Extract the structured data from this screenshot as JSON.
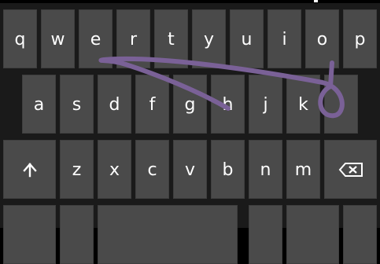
{
  "keyboard": {
    "row1": [
      "q",
      "w",
      "e",
      "r",
      "t",
      "y",
      "u",
      "i",
      "o",
      "p"
    ],
    "row2": [
      "a",
      "s",
      "d",
      "f",
      "g",
      "h",
      "j",
      "k",
      "l"
    ],
    "row3": [
      "z",
      "x",
      "c",
      "v",
      "b",
      "n",
      "m"
    ]
  },
  "colors": {
    "key_bg": "#4a4a4a",
    "key_text": "#ffffff",
    "keyboard_bg": "#1a1a1a",
    "swipe_trail": "#7a6197"
  },
  "icons": {
    "shift": "shift-arrow-icon",
    "backspace": "backspace-icon"
  }
}
